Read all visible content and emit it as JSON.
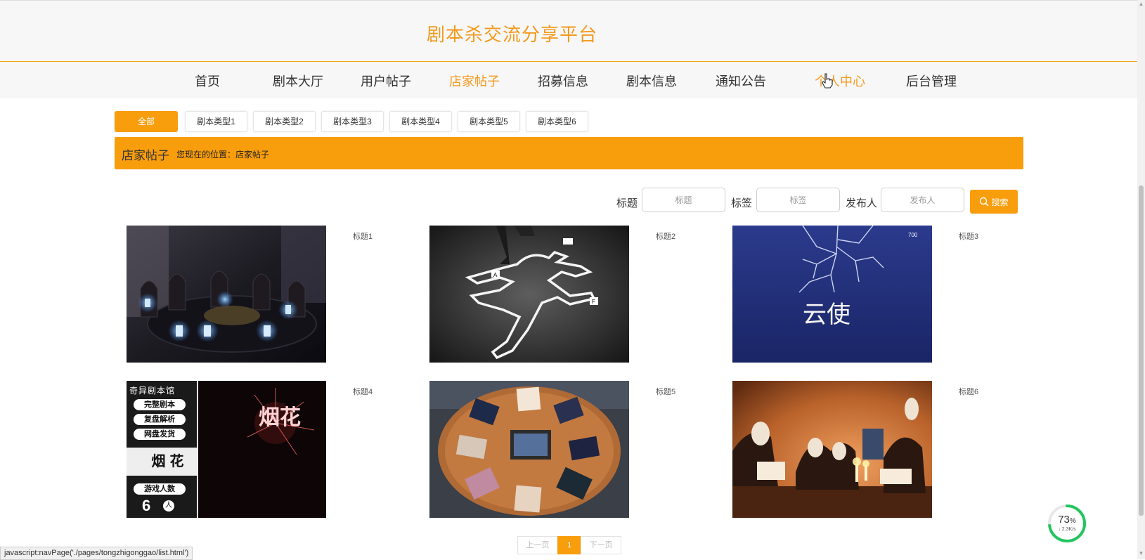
{
  "site": {
    "title": "剧本杀交流分享平台"
  },
  "nav": {
    "items": [
      {
        "label": "首页"
      },
      {
        "label": "剧本大厅"
      },
      {
        "label": "用户帖子"
      },
      {
        "label": "店家帖子",
        "active": true
      },
      {
        "label": "招募信息"
      },
      {
        "label": "剧本信息"
      },
      {
        "label": "通知公告"
      },
      {
        "label": "个人中心",
        "hover": true
      },
      {
        "label": "后台管理"
      }
    ]
  },
  "categories": [
    "全部",
    "剧本类型1",
    "剧本类型2",
    "剧本类型3",
    "剧本类型4",
    "剧本类型5",
    "剧本类型6"
  ],
  "banner": {
    "title": "店家帖子",
    "location": "您现在的位置：店家帖子"
  },
  "search": {
    "title_label": "标题",
    "title_placeholder": "标题",
    "tag_label": "标签",
    "tag_placeholder": "标签",
    "author_label": "发布人",
    "author_placeholder": "发布人",
    "button_label": "搜索"
  },
  "posts": [
    {
      "title": "标题1",
      "image": "dark room round table with glowing candles"
    },
    {
      "title": "标题2",
      "image": "chalk body outline crime scene"
    },
    {
      "title": "标题3",
      "image": "blue poster with white branches, text 云使"
    },
    {
      "title": "标题4",
      "image": "script poster 烟花"
    },
    {
      "title": "标题5",
      "image": "round wooden table with cards top-down"
    },
    {
      "title": "标题6",
      "image": "masked people reading by candlelight"
    }
  ],
  "poster4": {
    "shop": "奇异剧本馆",
    "tags": [
      "完整剧本",
      "复盘解析",
      "网盘发货"
    ],
    "name": "烟花",
    "players_label": "游戏人数",
    "players": "6",
    "players_unit": "人",
    "art_text": "烟花"
  },
  "poster3": {
    "art_text": "云使"
  },
  "pager": {
    "prev": "上一页",
    "current": "1",
    "next": "下一页"
  },
  "status_bar": {
    "text": "javascript:navPage('./pages/tongzhigonggao/list.html')"
  },
  "speed_widget": {
    "percent": "73",
    "percent_unit": "%",
    "rate": "↓ 2.3K/s",
    "level": 0.73
  },
  "colors": {
    "accent": "#f89d0c",
    "title": "#f39a1e"
  }
}
